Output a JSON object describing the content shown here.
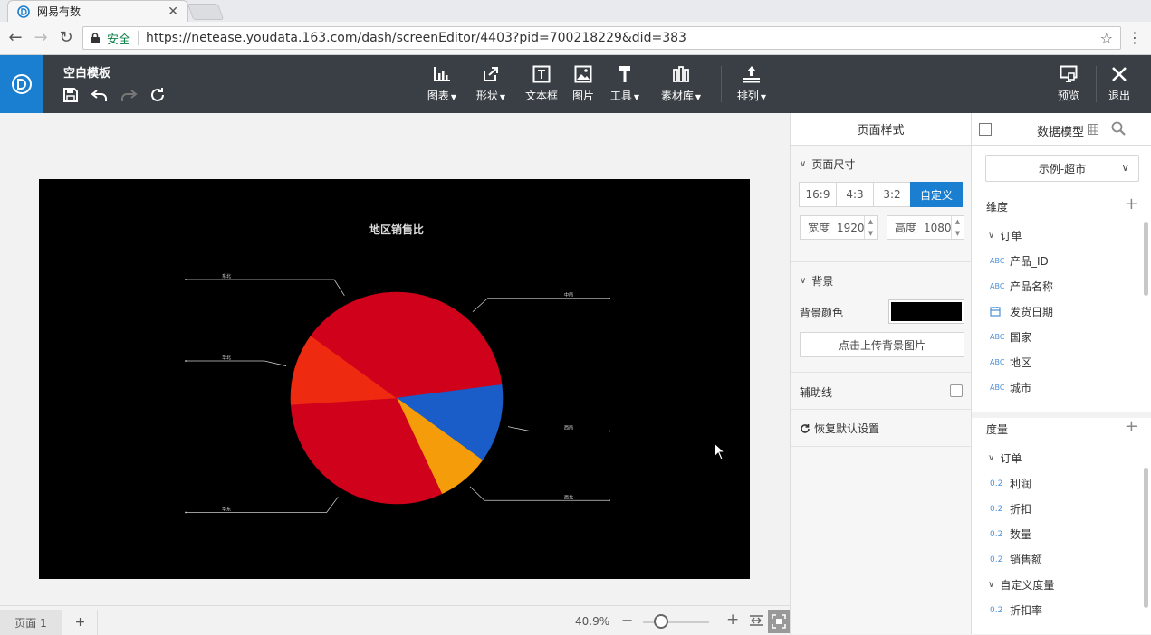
{
  "browser": {
    "tab_title": "网易有数",
    "secure_label": "安全",
    "url": "https://netease.youdata.163.com/dash/screenEditor/4403?pid=700218229&did=383"
  },
  "toolbar": {
    "doc_title": "空白模板",
    "tools": [
      {
        "label": "图表",
        "icon": "bar-chart-icon",
        "dropdown": true
      },
      {
        "label": "形状",
        "icon": "shape-icon",
        "dropdown": true
      },
      {
        "label": "文本框",
        "icon": "textbox-icon",
        "dropdown": false
      },
      {
        "label": "图片",
        "icon": "image-icon",
        "dropdown": false
      },
      {
        "label": "工具",
        "icon": "hammer-icon",
        "dropdown": true
      },
      {
        "label": "素材库",
        "icon": "library-icon",
        "dropdown": true
      },
      {
        "label": "排列",
        "icon": "arrange-icon",
        "dropdown": true
      }
    ],
    "preview_label": "预览",
    "exit_label": "退出"
  },
  "chart_data": {
    "type": "pie",
    "title": "地区销售比",
    "categories": [
      "中南",
      "西南",
      "西北",
      "华东",
      "华北",
      "东北"
    ],
    "values": [
      23,
      12,
      8,
      31,
      11,
      15
    ],
    "colors": [
      "#d0021b",
      "#1a5dc9",
      "#f59c0a",
      "#d0021b",
      "#ee2a10",
      "#d0021b"
    ],
    "background": "#000000"
  },
  "bottom": {
    "page_label": "页面 1",
    "add_label": "+",
    "zoom": "40.9%",
    "zoom_minus": "−",
    "zoom_plus": "+"
  },
  "style_panel": {
    "title": "页面样式",
    "size_section": "页面尺寸",
    "ratios": [
      "16:9",
      "4:3",
      "3:2",
      "自定义"
    ],
    "active_ratio": "自定义",
    "width_label": "宽度",
    "width_value": "1920",
    "height_label": "高度",
    "height_value": "1080",
    "bg_section": "背景",
    "bg_color_label": "背景颜色",
    "bg_color": "#000000",
    "upload_label": "点击上传背景图片",
    "guide_label": "辅助线",
    "reset_label": "恢复默认设置"
  },
  "data_panel": {
    "title": "数据模型",
    "model": "示例-超市",
    "dimension_title": "维度",
    "dimension_group": "订单",
    "dimensions": [
      {
        "label": "产品_ID",
        "type": "ABC"
      },
      {
        "label": "产品名称",
        "type": "ABC"
      },
      {
        "label": "发货日期",
        "type": "date"
      },
      {
        "label": "国家",
        "type": "ABC"
      },
      {
        "label": "地区",
        "type": "ABC"
      },
      {
        "label": "城市",
        "type": "ABC"
      }
    ],
    "measure_title": "度量",
    "measure_group": "订单",
    "measures": [
      {
        "label": "利润",
        "type": "0.2"
      },
      {
        "label": "折扣",
        "type": "0.2"
      },
      {
        "label": "数量",
        "type": "0.2"
      },
      {
        "label": "销售额",
        "type": "0.2"
      }
    ],
    "custom_group": "自定义度量",
    "custom_measures": [
      {
        "label": "折扣率",
        "type": "0.2"
      }
    ]
  }
}
